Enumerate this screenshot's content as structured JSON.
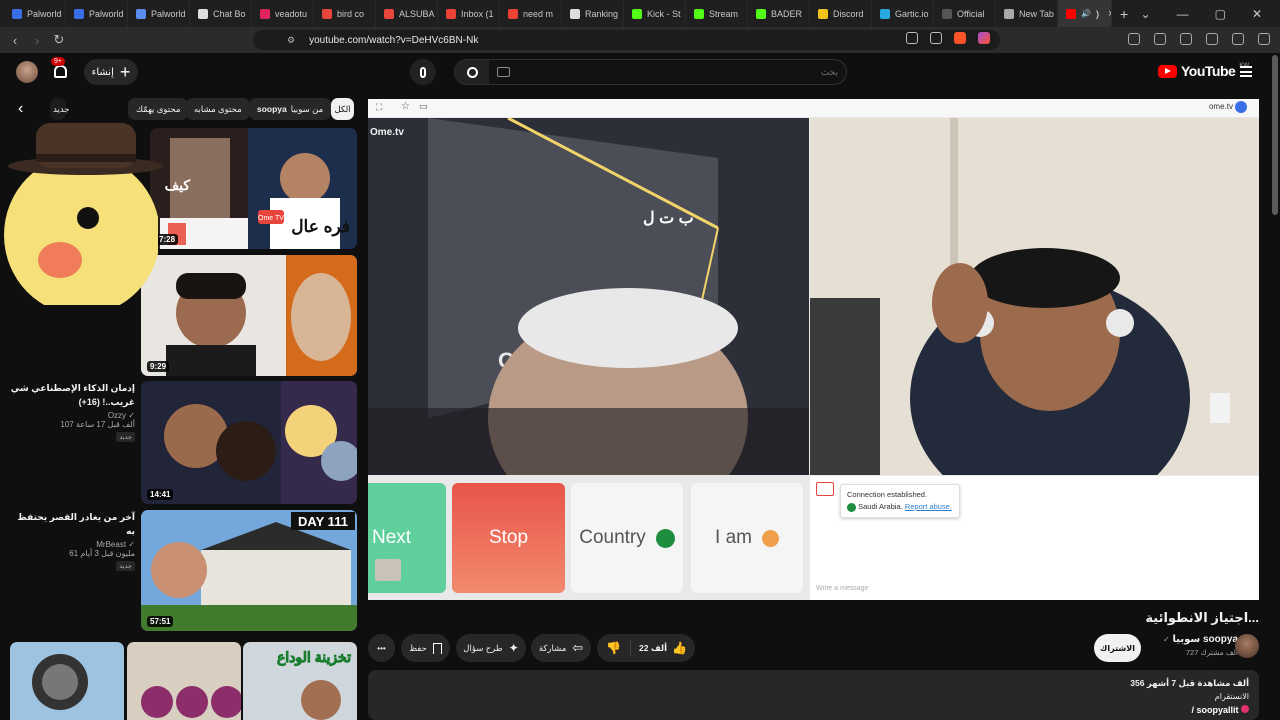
{
  "tabs": [
    {
      "label": "Palworld",
      "color": "#3a6ee8"
    },
    {
      "label": "Palworld",
      "color": "#3a6ee8"
    },
    {
      "label": "Palworld",
      "color": "#5a8dee"
    },
    {
      "label": "Chat Bo",
      "color": "#dddddd"
    },
    {
      "label": "veadotu",
      "color": "#e0245e"
    },
    {
      "label": "bird co",
      "color": "#e8453c"
    },
    {
      "label": "ALSUBA",
      "color": "#e8453c"
    },
    {
      "label": "Inbox (1",
      "color": "#ea4335"
    },
    {
      "label": "need m",
      "color": "#ea4335"
    },
    {
      "label": "Ranking",
      "color": "#dddddd"
    },
    {
      "label": "Kick - St",
      "color": "#53fc18"
    },
    {
      "label": "Stream",
      "color": "#53fc18"
    },
    {
      "label": "BADER",
      "color": "#53fc18"
    },
    {
      "label": "Discord",
      "color": "#f0c419"
    },
    {
      "label": "Gartic.io",
      "color": "#27a9e1"
    },
    {
      "label": "Official",
      "color": "#555555"
    },
    {
      "label": "New Tab",
      "color": "#aaaaaa"
    }
  ],
  "active_tab": {
    "label": ")",
    "close": "×"
  },
  "new_tab": "+",
  "address": {
    "url": "youtube.com/watch?v=DeHVc6BN-Nk"
  },
  "yt": {
    "logo": "YouTube",
    "region": "KW",
    "search_placeholder": "بحث",
    "create_label": "إنشاء",
    "notif_count": "9+"
  },
  "chips": [
    "الكل",
    "من سوبيا",
    "soopya",
    "محتوى مشابه",
    "محتوى يهمّك",
    "جديد"
  ],
  "recs": [
    {
      "duration": "7:28",
      "title": "",
      "channel": "",
      "meta": ""
    },
    {
      "duration": "9:29",
      "title": "",
      "channel": "",
      "meta": ""
    },
    {
      "duration": "14:41",
      "title": "إدمان الذكاء الإصطناعي شي غريب..! (16+)",
      "channel": "Ozzy",
      "meta": "107 ألف  قبل 17 ساعة",
      "badge": "جديد"
    },
    {
      "duration": "57:51",
      "title": "آخر من يغادر القصر يحتفظ به",
      "channel": "MrBeast",
      "meta": "61 مليون  قبل 3 أيام",
      "badge": "جديد"
    }
  ],
  "rec_hidden": "01",
  "player": {
    "brand": "Ome.tv",
    "brand_short": "ome.tv",
    "buttons": [
      {
        "label": "Next",
        "bg": "#5fcf9b"
      },
      {
        "label": "Stop",
        "bg": "#ea6154"
      },
      {
        "label": "Country",
        "bg": "#f5f5f5"
      },
      {
        "label": "I am",
        "bg": "#f5f5f5"
      }
    ],
    "chat_line1": "Connection established.",
    "chat_line2": "Saudi Arabia.",
    "chat_link": "Report abuse.",
    "chat_placeholder": "Write a message",
    "sign_text": "ب ت ل",
    "sign_text2": "OVC"
  },
  "thumb_text": {
    "t1": "فره عال",
    "t2": "كيف",
    "t3": "DAY 111",
    "t4": "تخزينة الوداع",
    "ome": "Ome TV"
  },
  "video": {
    "title": "اجتياز الانطوائية...",
    "channel": "سوبيا soopya",
    "subs": "727 ألف مشترك",
    "subscribe": "الاشتراك",
    "likes": "22 ألف",
    "share": "مشاركة",
    "ask": "طرح سؤال",
    "save": "حفظ",
    "more": "•••",
    "views": "356 ألف مشاهدة  قبل 7 أشهر",
    "desc_line": "الانستقرام",
    "link": "/ soopyallit"
  },
  "colors": {
    "accent": "#ff0000",
    "bg": "#0f0f0f",
    "pill": "#272727"
  }
}
